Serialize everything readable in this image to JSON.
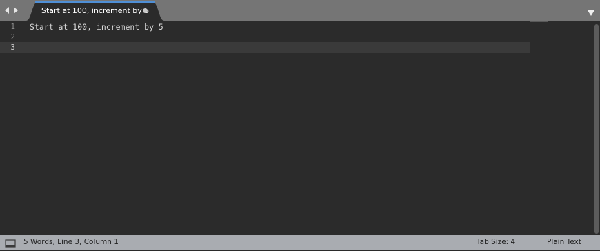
{
  "tab": {
    "title": "Start at 100, increment by 5",
    "dirty": true,
    "accent_color": "#4f8fd6"
  },
  "icons": {
    "nav_back": "chevron-left-icon",
    "nav_forward": "chevron-right-icon",
    "tab_menu": "triangle-down-icon",
    "status_panel": "panel-toggle-icon"
  },
  "editor": {
    "lines": [
      {
        "number": "1",
        "text": "Start at 100, increment by 5"
      },
      {
        "number": "2",
        "text": ""
      },
      {
        "number": "3",
        "text": ""
      }
    ],
    "active_line": 3
  },
  "status": {
    "position": "5 Words, Line 3, Column 1",
    "tab_size": "Tab Size: 4",
    "syntax": "Plain Text"
  },
  "colors": {
    "tabbar_bg": "#757575",
    "editor_bg": "#2b2b2b",
    "statusbar_bg": "#a9acb1"
  }
}
